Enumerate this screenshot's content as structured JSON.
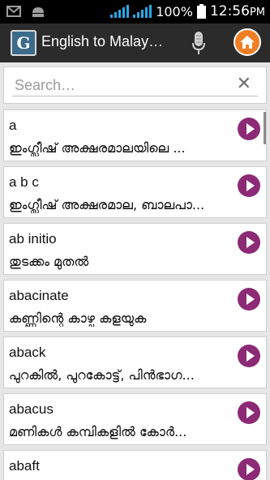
{
  "status_bar": {
    "battery_percent": "100%",
    "time": "12:56",
    "time_suffix": "PM"
  },
  "action_bar": {
    "title": "English to Malay…",
    "logo_glyph": "G"
  },
  "search": {
    "placeholder": "Search…",
    "clear_icon": "✕"
  },
  "words": [
    {
      "word": "a",
      "meaning": "ഇംഗ്ലീഷ് അക്ഷരമാലയിലെ ..."
    },
    {
      "word": "a b c",
      "meaning": "ഇംഗ്ലീഷ് അക്ഷരമാല, ബാലപാ..."
    },
    {
      "word": "ab initio",
      "meaning": "തുടക്കം മുതൽ"
    },
    {
      "word": "abacinate",
      "meaning": "കണ്ണിന്റെ കാഴ്ച കളയുക"
    },
    {
      "word": "aback",
      "meaning": "പുറകിൽ, പുറകോട്ട്, പിൻഭാഗ..."
    },
    {
      "word": "abacus",
      "meaning": "മണികൾ കമ്പികളിൽ കോർ..."
    },
    {
      "word": "abaft",
      "meaning": ""
    }
  ],
  "colors": {
    "accent": "#8c2a76",
    "actionbar": "#2b2b2b",
    "home": "#f07e24",
    "signal": "#2aa7e6"
  }
}
